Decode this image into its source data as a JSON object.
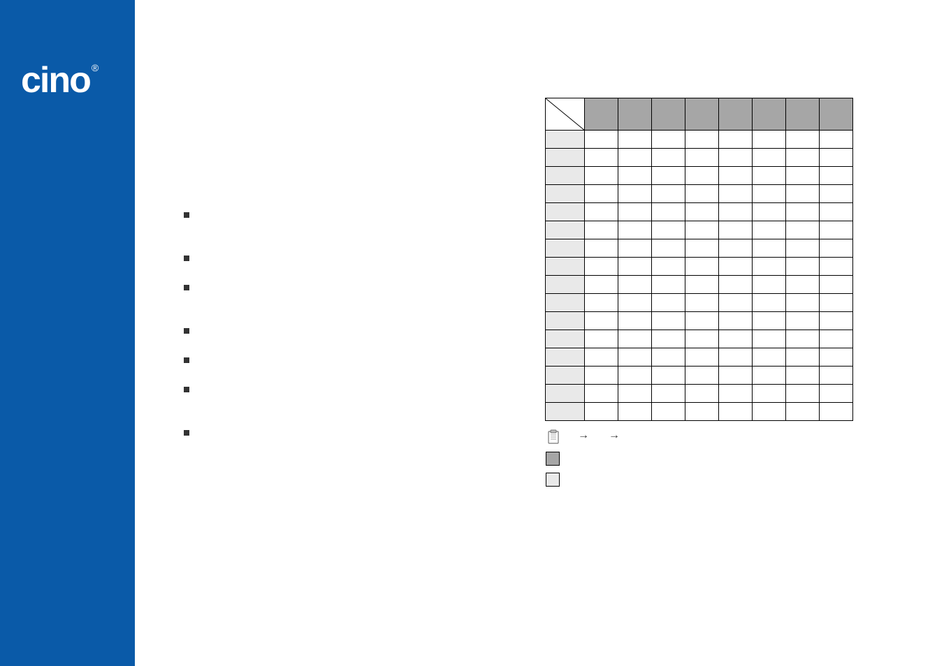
{
  "brand": "cino",
  "bullets": [
    "",
    "",
    "",
    "",
    "",
    "",
    ""
  ],
  "table": {
    "cols": 8,
    "rows": 16,
    "col_headers": [
      "",
      "",
      "",
      "",
      "",
      "",
      "",
      ""
    ],
    "row_headers": [
      "",
      "",
      "",
      "",
      "",
      "",
      "",
      "",
      "",
      "",
      "",
      "",
      "",
      "",
      "",
      ""
    ]
  },
  "legend": {
    "note_segments": [
      "",
      "",
      ""
    ],
    "dark_label": "",
    "light_label": ""
  }
}
